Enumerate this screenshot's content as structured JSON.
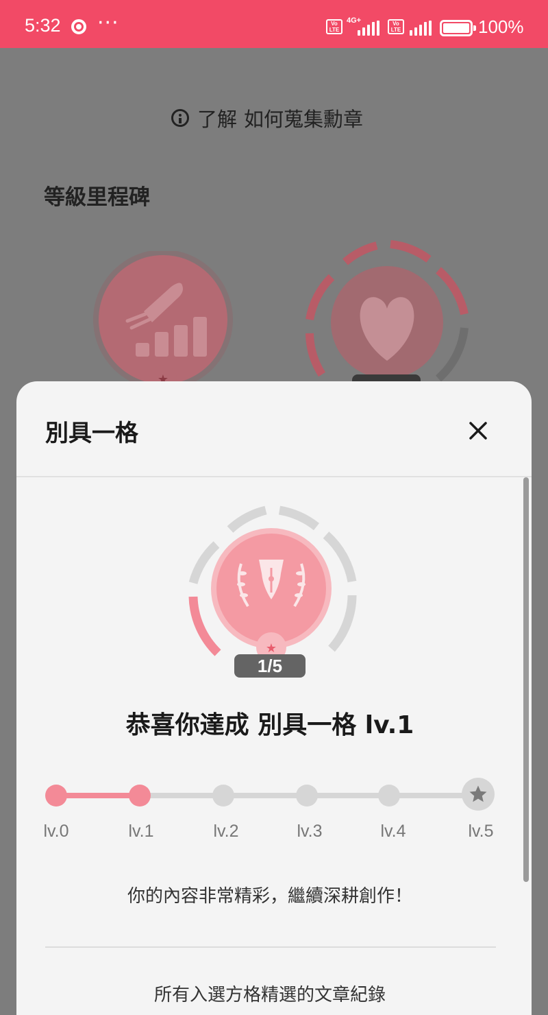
{
  "status_bar": {
    "time": "5:32",
    "dots": "···",
    "volte": "Vo\nLTE",
    "network": "4G+",
    "battery": "100%"
  },
  "background": {
    "howto_prefix": "了解",
    "howto_link": "如何蒐集勳章",
    "section_title": "等級里程碑",
    "badges": [
      {
        "name": "rocket-growth",
        "icon": "rocket-chart-icon"
      },
      {
        "name": "heart",
        "icon": "heart-icon"
      }
    ]
  },
  "sheet": {
    "title": "別具一格",
    "badge_progress": "1/5",
    "badge_icon": "fountain-pen-laurel-icon",
    "congrats": "恭喜你達成 別具一格 lv.1",
    "levels": [
      "lv.0",
      "lv.1",
      "lv.2",
      "lv.3",
      "lv.4",
      "lv.5"
    ],
    "achieved_level": 1,
    "message": "你的內容非常精彩，繼續深耕創作！",
    "record_title": "所有入選方格精選的文章紀錄"
  },
  "colors": {
    "status_bar": "#f24a66",
    "accent": "#f38a97",
    "overlay": "#7d7d7d",
    "sheet_bg": "#f4f4f4",
    "inactive": "#d6d6d6"
  }
}
